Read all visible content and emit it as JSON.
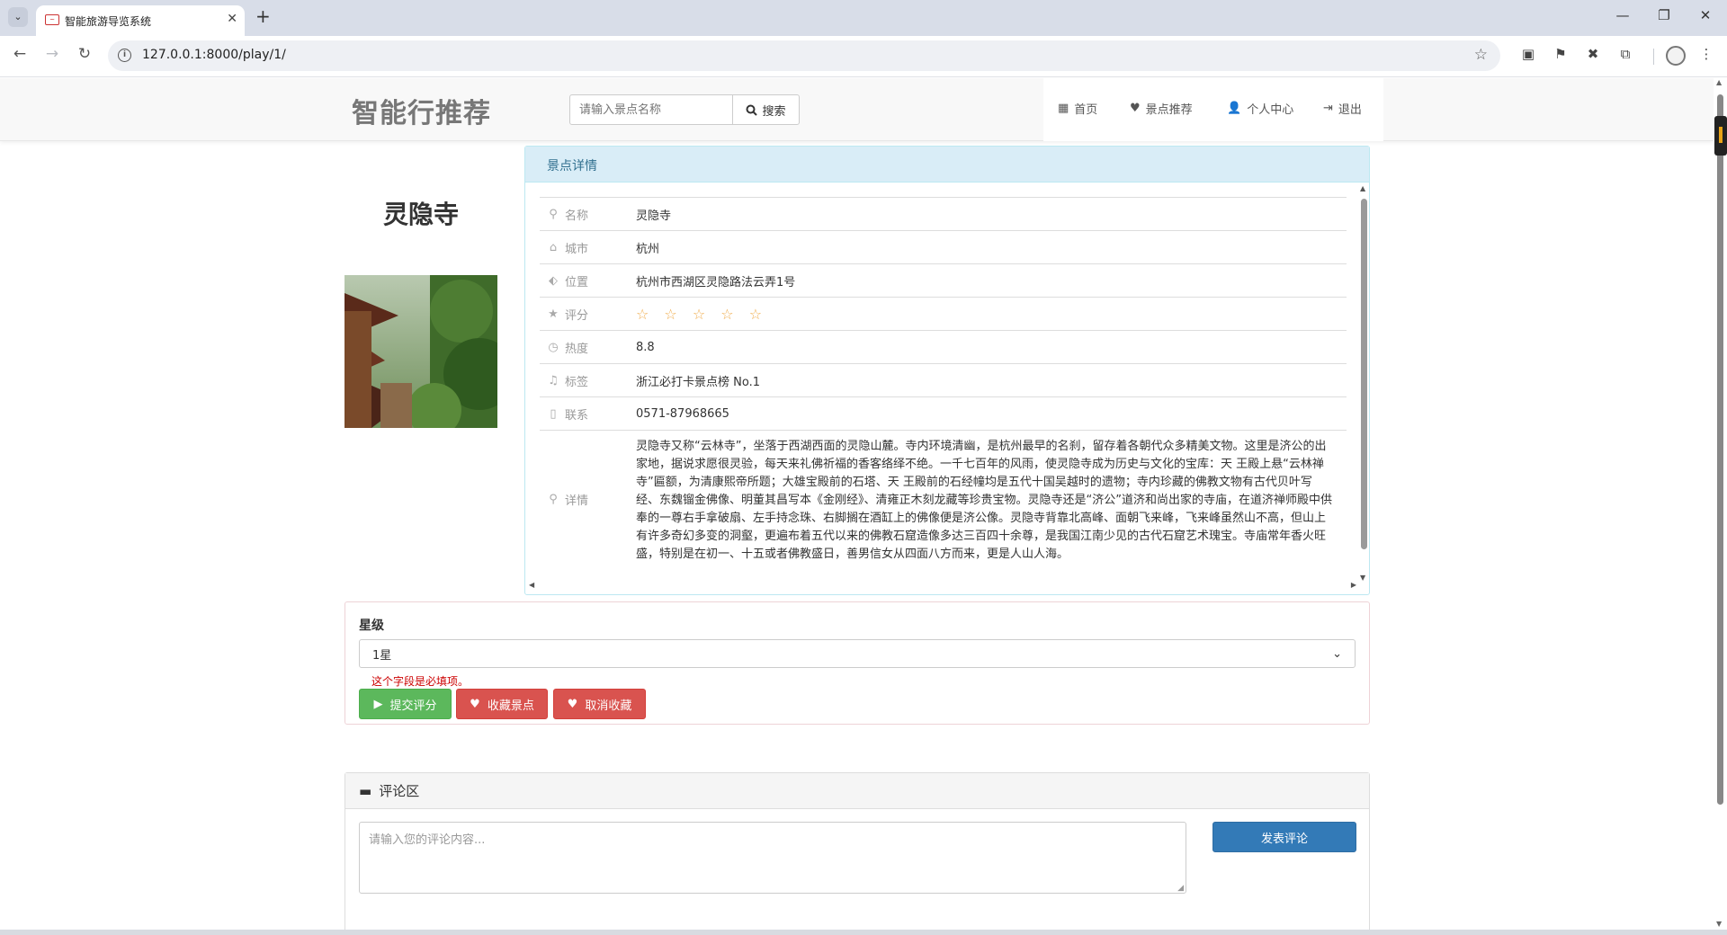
{
  "browser": {
    "tab_title": "智能旅游导览系统",
    "url": "127.0.0.1:8000/play/1/"
  },
  "header": {
    "brand": "智能行推荐",
    "search_placeholder": "请输入景点名称",
    "search_button": "搜索",
    "nav": [
      {
        "label": "首页",
        "icon": "grid-icon"
      },
      {
        "label": "景点推荐",
        "icon": "heart-icon"
      },
      {
        "label": "个人中心",
        "icon": "user-icon"
      },
      {
        "label": "退出",
        "icon": "logout-icon"
      }
    ]
  },
  "place": {
    "title": "灵隐寺",
    "photo_alt": "temple-photo"
  },
  "detail_panel": {
    "heading": "景点详情",
    "rows": [
      {
        "label": "名称",
        "icon": "search-icon",
        "value": "灵隐寺"
      },
      {
        "label": "城市",
        "icon": "home-icon",
        "value": "杭州"
      },
      {
        "label": "位置",
        "icon": "tags-icon",
        "value": "杭州市西湖区灵隐路法云弄1号"
      },
      {
        "label": "评分",
        "icon": "star-icon",
        "value": "☆ ☆ ☆ ☆ ☆"
      },
      {
        "label": "热度",
        "icon": "clock-icon",
        "value": "8.8"
      },
      {
        "label": "标签",
        "icon": "bell-icon",
        "value": "浙江必打卡景点榜 No.1"
      },
      {
        "label": "联系",
        "icon": "phone-icon",
        "value": "0571-87968665"
      },
      {
        "label": "详情",
        "icon": "map-marker-icon",
        "value": "灵隐寺又称“云林寺”，坐落于西湖西面的灵隐山麓。寺内环境清幽，是杭州最早的名刹，留存着各朝代众多精美文物。这里是济公的出家地，据说求愿很灵验，每天来礼佛祈福的香客络绎不绝。一千七百年的风雨，使灵隐寺成为历史与文化的宝库：天 王殿上悬“云林禅寺”匾额，为清康熙帝所题；大雄宝殿前的石塔、天 王殿前的石经幢均是五代十国吴越时的遗物；寺内珍藏的佛教文物有古代贝叶写经、东魏镏金佛像、明董其昌写本《金刚经》、清雍正木刻龙藏等珍贵宝物。灵隐寺还是“济公”道济和尚出家的寺庙，在道济禅师殿中供奉的一尊右手拿破扇、左手持念珠、右脚搁在酒缸上的佛像便是济公像。灵隐寺背靠北高峰、面朝飞来峰，飞来峰虽然山不高，但山上有许多奇幻多变的洞壑，更遍布着五代以来的佛教石窟造像多达三百四十余尊，是我国江南少见的古代石窟艺术瑰宝。寺庙常年香火旺盛，特别是在初一、十五或者佛教盛日，善男信女从四面八方而来，更是人山人海。"
      }
    ]
  },
  "rating_form": {
    "label": "星级",
    "selected": "1星",
    "error": "这个字段是必填项。",
    "submit_button": "提交评分",
    "favorite_button": "收藏景点",
    "unfavorite_button": "取消收藏"
  },
  "comments": {
    "heading": "评论区",
    "placeholder": "请输入您的评论内容...",
    "submit_button": "发表评论"
  },
  "colors": {
    "panel_info_bg": "#d9edf7",
    "success": "#5cb85c",
    "danger": "#d9534f",
    "primary": "#337ab7",
    "star": "#f0ad4e"
  }
}
